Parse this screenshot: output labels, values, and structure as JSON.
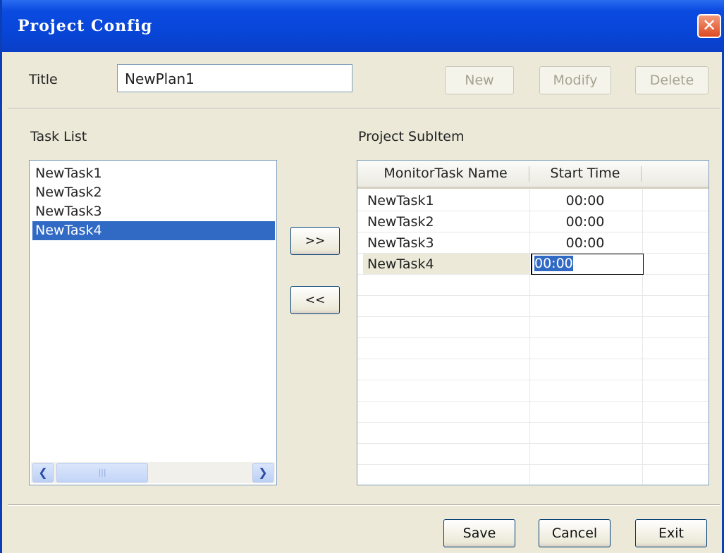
{
  "window": {
    "title": "Project Config",
    "close_glyph": "✕"
  },
  "title_field": {
    "label": "Title",
    "value": "NewPlan1"
  },
  "top_buttons": {
    "new": "New",
    "modify": "Modify",
    "delete": "Delete"
  },
  "task_list": {
    "label": "Task List",
    "items": [
      "NewTask1",
      "NewTask2",
      "NewTask3",
      "NewTask4"
    ],
    "selected": "NewTask4"
  },
  "move_buttons": {
    "add": ">>",
    "remove": "<<"
  },
  "subitem": {
    "label": "Project SubItem",
    "columns": [
      "MonitorTask Name",
      "Start Time"
    ],
    "rows": [
      {
        "name": "NewTask1",
        "start": "00:00"
      },
      {
        "name": "NewTask2",
        "start": "00:00"
      },
      {
        "name": "NewTask3",
        "start": "00:00"
      },
      {
        "name": "NewTask4",
        "start": "00:00"
      }
    ]
  },
  "bottom_buttons": {
    "save": "Save",
    "cancel": "Cancel",
    "exit": "Exit"
  },
  "icons": {
    "close": "close-icon",
    "scroll_left": "chevron-left-icon",
    "scroll_right": "chevron-right-icon"
  }
}
